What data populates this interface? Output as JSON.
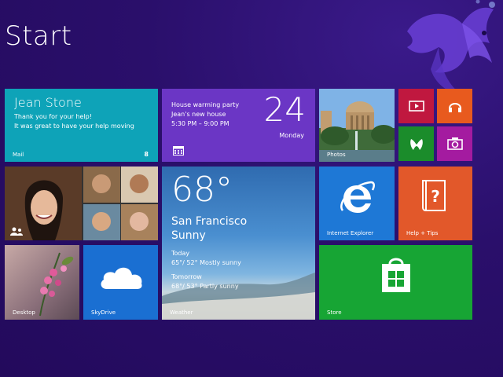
{
  "screen": {
    "title": "Start"
  },
  "tiles": {
    "mail": {
      "sender": "Jean Stone",
      "line1": "Thank you for your help!",
      "line2": "It was great to have your help moving",
      "label": "Mail",
      "count": "8"
    },
    "calendar": {
      "event": "House warming party",
      "location": "Jean's new house",
      "time": "5:30 PM – 9:00 PM",
      "day": "24",
      "weekday": "Monday"
    },
    "photos": {
      "label": "Photos"
    },
    "video": {
      "icon": "video-icon"
    },
    "music": {
      "icon": "headphones-icon"
    },
    "games": {
      "icon": "gamepad-icon"
    },
    "camera": {
      "icon": "camera-icon"
    },
    "people": {
      "icon": "people-icon"
    },
    "weather": {
      "temperature": "68°",
      "city": "San Francisco",
      "condition": "Sunny",
      "today_label": "Today",
      "today_forecast": "65°/ 52° Mostly sunny",
      "tomorrow_label": "Tomorrow",
      "tomorrow_forecast": "68°/ 53° Partly sunny",
      "label": "Weather"
    },
    "ie": {
      "label": "Internet Explorer"
    },
    "help": {
      "label": "Help + Tips"
    },
    "desktop": {
      "label": "Desktop"
    },
    "skydrive": {
      "label": "SkyDrive"
    },
    "store": {
      "label": "Store"
    }
  },
  "colors": {
    "background": "#2a0f6b",
    "mail": "#0ea3b8",
    "calendar": "#6b36c5",
    "video": "#c0183f",
    "music": "#e85a1e",
    "games": "#1b8c2b",
    "camera": "#a41ba0",
    "ie": "#1e78d6",
    "help": "#e2582a",
    "skydrive": "#1a6fd2",
    "store": "#17a534"
  }
}
